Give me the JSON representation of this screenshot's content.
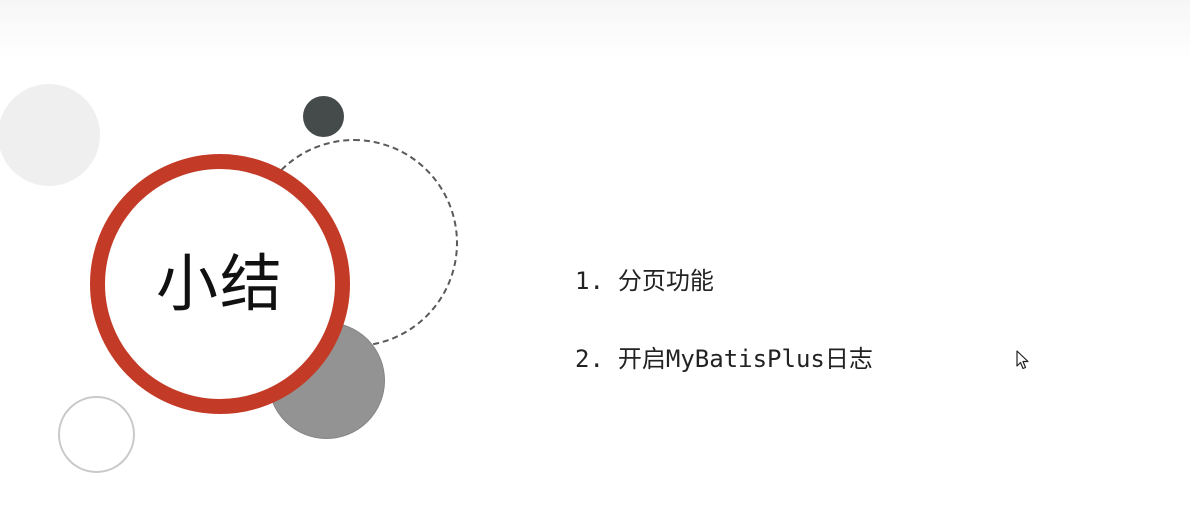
{
  "slide": {
    "title": "小结",
    "items": [
      {
        "number": "1.",
        "text": "分页功能"
      },
      {
        "number": "2.",
        "text": "开启MyBatisPlus日志"
      }
    ]
  },
  "colors": {
    "accent_red": "#c33a26",
    "dark_dot": "#454a4b",
    "gray_circle": "#939393",
    "light_circle": "#efefef"
  },
  "icons": {
    "cursor": "mouse-pointer-icon"
  }
}
